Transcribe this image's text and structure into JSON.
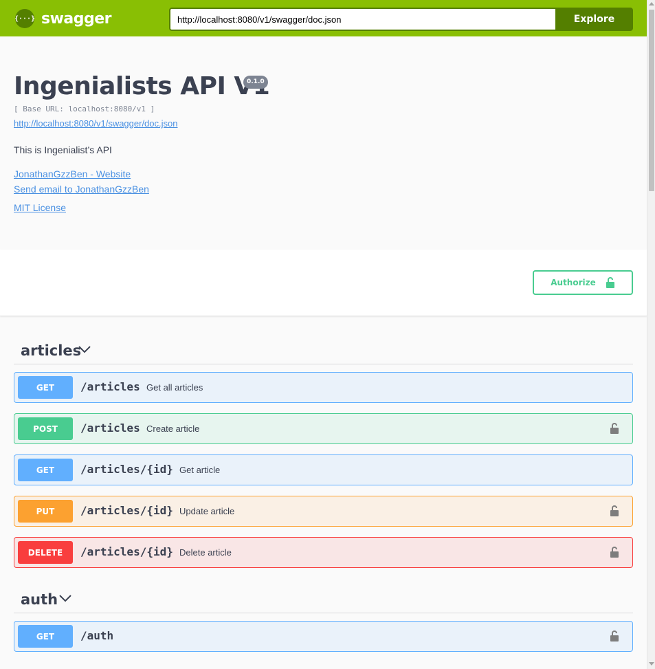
{
  "topbar": {
    "logo_mark": "{···}",
    "logo_text": "swagger",
    "url_value": "http://localhost:8080/v1/swagger/doc.json",
    "explore_label": "Explore",
    "colors": {
      "bar": "#89bf04",
      "dark": "#547f00"
    }
  },
  "info": {
    "title": "Ingenialists API V1",
    "version": "0.1.0",
    "base_url": "[ Base URL: localhost:8080/v1 ]",
    "spec_link": "http://localhost:8080/v1/swagger/doc.json",
    "description": "This is Ingenialist’s API",
    "website_link": "JonathanGzzBen - Website",
    "email_link": "Send email to JonathanGzzBen",
    "license_link": "MIT License"
  },
  "authorize": {
    "label": "Authorize",
    "icon": "unlocked-lock-icon",
    "color": "#49cc90"
  },
  "tags": [
    {
      "name": "articles",
      "operations": [
        {
          "method": "GET",
          "path": "/articles",
          "summary": "Get all articles",
          "locked": false
        },
        {
          "method": "POST",
          "path": "/articles",
          "summary": "Create article",
          "locked": true
        },
        {
          "method": "GET",
          "path": "/articles/{id}",
          "summary": "Get article",
          "locked": false
        },
        {
          "method": "PUT",
          "path": "/articles/{id}",
          "summary": "Update article",
          "locked": true
        },
        {
          "method": "DELETE",
          "path": "/articles/{id}",
          "summary": "Delete article",
          "locked": true
        }
      ]
    },
    {
      "name": "auth",
      "operations": [
        {
          "method": "GET",
          "path": "/auth",
          "summary": "",
          "locked": true
        }
      ]
    }
  ],
  "method_colors": {
    "GET": "#61affe",
    "POST": "#49cc90",
    "PUT": "#fca130",
    "DELETE": "#f93e3e"
  }
}
